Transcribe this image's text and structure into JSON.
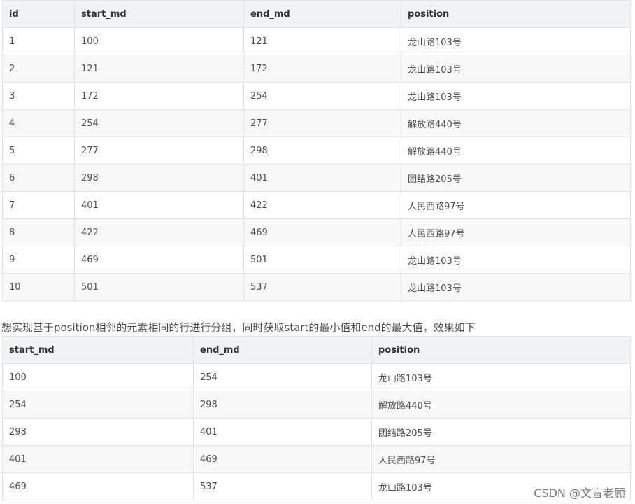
{
  "table1": {
    "headers": [
      "id",
      "start_md",
      "end_md",
      "position"
    ],
    "rows": [
      [
        "1",
        "100",
        "121",
        "龙山路103号"
      ],
      [
        "2",
        "121",
        "172",
        "龙山路103号"
      ],
      [
        "3",
        "172",
        "254",
        "龙山路103号"
      ],
      [
        "4",
        "254",
        "277",
        "解放路440号"
      ],
      [
        "5",
        "277",
        "298",
        "解放路440号"
      ],
      [
        "6",
        "298",
        "401",
        "团结路205号"
      ],
      [
        "7",
        "401",
        "422",
        "人民西路97号"
      ],
      [
        "8",
        "422",
        "469",
        "人民西路97号"
      ],
      [
        "9",
        "469",
        "501",
        "龙山路103号"
      ],
      [
        "10",
        "501",
        "537",
        "龙山路103号"
      ]
    ]
  },
  "description": "想实现基于position相邻的元素相同的行进行分组，同时获取start的最小值和end的最大值，效果如下",
  "table2": {
    "headers": [
      "start_md",
      "end_md",
      "position"
    ],
    "rows": [
      [
        "100",
        "254",
        "龙山路103号"
      ],
      [
        "254",
        "298",
        "解放路440号"
      ],
      [
        "298",
        "401",
        "团结路205号"
      ],
      [
        "401",
        "469",
        "人民西路97号"
      ],
      [
        "469",
        "537",
        "龙山路103号"
      ]
    ]
  },
  "watermark": "CSDN @文盲老顾"
}
